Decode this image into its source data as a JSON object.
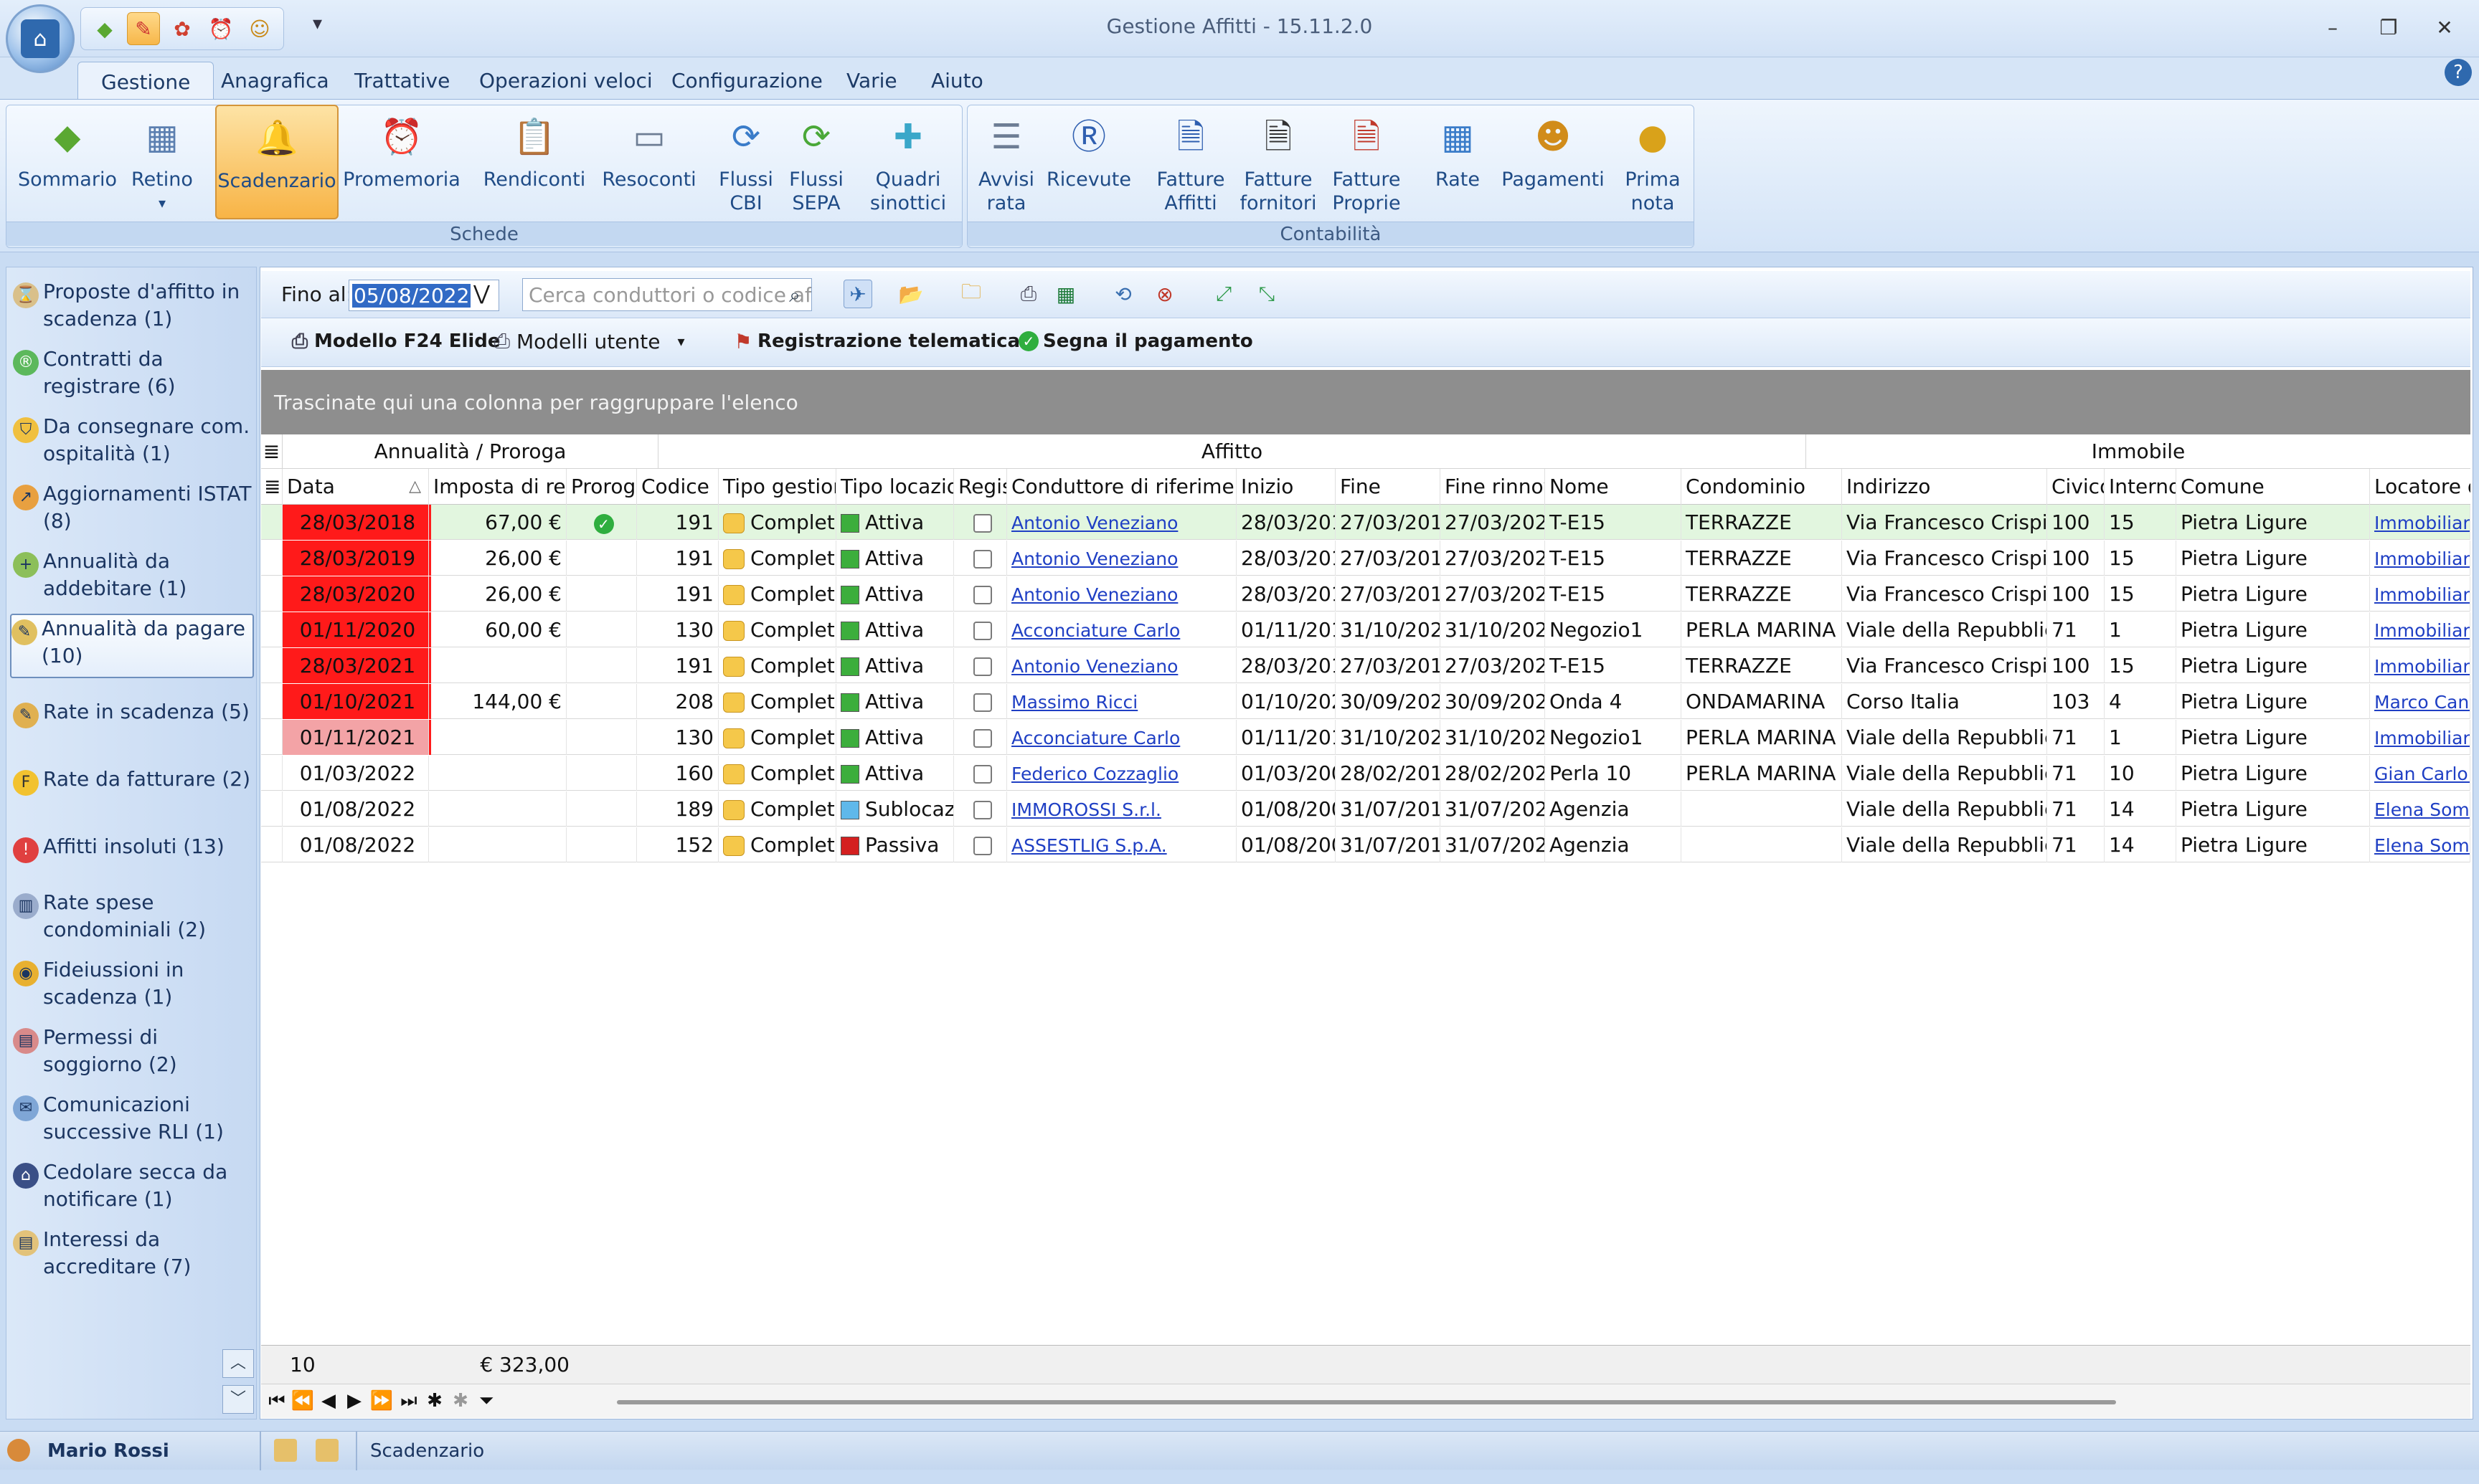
{
  "window": {
    "title": "Gestione Affitti - 15.11.2.0",
    "minimize": "–",
    "maximize": "❐",
    "close": "✕"
  },
  "qat": {
    "more": "▾"
  },
  "tabs": [
    "Gestione",
    "Anagrafica",
    "Trattative",
    "Operazioni veloci",
    "Configurazione",
    "Varie",
    "Aiuto"
  ],
  "ribbon": {
    "group_schede": "Schede",
    "group_contabilita": "Contabilità",
    "buttons": [
      "Sommario",
      "Retino",
      "Scadenzario",
      "Promemoria",
      "Rendiconti",
      "Resoconti",
      "Flussi CBI",
      "Flussi SEPA",
      "Quadri sinottici",
      "Avvisi rata",
      "Ricevute",
      "Fatture Affitti",
      "Fatture fornitori",
      "Fatture Proprie",
      "Rate",
      "Pagamenti",
      "Prima nota"
    ]
  },
  "left_panel": [
    "Proposte d'affitto in scadenza (1)",
    "Contratti da registrare (6)",
    "Da consegnare com. ospitalità (1)",
    "Aggiornamenti ISTAT (8)",
    "Annualità da addebitare (1)",
    "Annualità da pagare (10)",
    "Rate in scadenza (5)",
    "Rate da fatturare (2)",
    "Affitti insoluti (13)",
    "Rate spese condominiali (2)",
    "Fideiussioni in scadenza (1)",
    "Permessi di soggiorno (2)",
    "Comunicazioni successive RLI (1)",
    "Cedolare secca da notificare (1)",
    "Interessi da accreditare (7)"
  ],
  "toolbar": {
    "fino_al_label": "Fino al:",
    "fino_al_value": "05/08/2022",
    "search_placeholder": "Cerca conduttori o codice af",
    "modello_f24": "Modello F24 Elide",
    "modelli_utente": "Modelli utente",
    "registrazione": "Registrazione telematica",
    "segna_pagamento": "Segna il pagamento"
  },
  "groupbar": "Trascinate qui una colonna per raggruppare l'elenco",
  "bands": {
    "annualita": "Annualità / Proroga",
    "affitto": "Affitto",
    "immobile": "Immobile"
  },
  "columns": [
    "Data",
    "Imposta di reg",
    "Proroga",
    "Codice",
    "Tipo gestion",
    "Tipo locazior",
    "Regis",
    "Conduttore di riferimento",
    "Inizio",
    "Fine",
    "Fine rinnov",
    "Nome",
    "Condominio",
    "Indirizzo",
    "Civico",
    "Interno",
    "Comune",
    "Locatore d"
  ],
  "rows": [
    {
      "data": "28/03/2018",
      "imposta": "67,00 €",
      "proroga": "✓",
      "codice": "191",
      "gestione": "Complet",
      "locazione": "Attiva",
      "conduttore": "Antonio Veneziano",
      "inizio": "28/03/201",
      "fine": "27/03/201",
      "fine_rinnovo": "27/03/202",
      "nome": "T-E15",
      "condominio": "TERRAZZE",
      "indirizzo": "Via Francesco Crispi",
      "civico": "100",
      "interno": "15",
      "comune": "Pietra Ligure",
      "locatore": "Immobiliare"
    },
    {
      "data": "28/03/2019",
      "imposta": "26,00 €",
      "proroga": "",
      "codice": "191",
      "gestione": "Complet",
      "locazione": "Attiva",
      "conduttore": "Antonio Veneziano",
      "inizio": "28/03/201",
      "fine": "27/03/201",
      "fine_rinnovo": "27/03/202",
      "nome": "T-E15",
      "condominio": "TERRAZZE",
      "indirizzo": "Via Francesco Crispi",
      "civico": "100",
      "interno": "15",
      "comune": "Pietra Ligure",
      "locatore": "Immobiliare"
    },
    {
      "data": "28/03/2020",
      "imposta": "26,00 €",
      "proroga": "",
      "codice": "191",
      "gestione": "Complet",
      "locazione": "Attiva",
      "conduttore": "Antonio Veneziano",
      "inizio": "28/03/201",
      "fine": "27/03/201",
      "fine_rinnovo": "27/03/202",
      "nome": "T-E15",
      "condominio": "TERRAZZE",
      "indirizzo": "Via Francesco Crispi",
      "civico": "100",
      "interno": "15",
      "comune": "Pietra Ligure",
      "locatore": "Immobiliare"
    },
    {
      "data": "01/11/2020",
      "imposta": "60,00 €",
      "proroga": "",
      "codice": "130",
      "gestione": "Complet",
      "locazione": "Attiva",
      "conduttore": "Acconciature Carlo",
      "inizio": "01/11/201",
      "fine": "31/10/202",
      "fine_rinnovo": "31/10/202",
      "nome": "Negozio1",
      "condominio": "PERLA MARINA",
      "indirizzo": "Viale della Repubblica",
      "civico": "71",
      "interno": "1",
      "comune": "Pietra Ligure",
      "locatore": "Immobiliare"
    },
    {
      "data": "28/03/2021",
      "imposta": "",
      "proroga": "",
      "codice": "191",
      "gestione": "Complet",
      "locazione": "Attiva",
      "conduttore": "Antonio Veneziano",
      "inizio": "28/03/201",
      "fine": "27/03/201",
      "fine_rinnovo": "27/03/202",
      "nome": "T-E15",
      "condominio": "TERRAZZE",
      "indirizzo": "Via Francesco Crispi",
      "civico": "100",
      "interno": "15",
      "comune": "Pietra Ligure",
      "locatore": "Immobiliare"
    },
    {
      "data": "01/10/2021",
      "imposta": "144,00 €",
      "proroga": "",
      "codice": "208",
      "gestione": "Complet",
      "locazione": "Attiva",
      "conduttore": "Massimo Ricci",
      "inizio": "01/10/202",
      "fine": "30/09/202",
      "fine_rinnovo": "30/09/202",
      "nome": "Onda 4",
      "condominio": "ONDAMARINA",
      "indirizzo": "Corso Italia",
      "civico": "103",
      "interno": "4",
      "comune": "Pietra Ligure",
      "locatore": "Marco Cane"
    },
    {
      "data": "01/11/2021",
      "imposta": "",
      "proroga": "",
      "codice": "130",
      "gestione": "Complet",
      "locazione": "Attiva",
      "conduttore": "Acconciature Carlo",
      "inizio": "01/11/201",
      "fine": "31/10/202",
      "fine_rinnovo": "31/10/202",
      "nome": "Negozio1",
      "condominio": "PERLA MARINA",
      "indirizzo": "Viale della Repubblica",
      "civico": "71",
      "interno": "1",
      "comune": "Pietra Ligure",
      "locatore": "Immobiliare"
    },
    {
      "data": "01/03/2022",
      "imposta": "",
      "proroga": "",
      "codice": "160",
      "gestione": "Complet",
      "locazione": "Attiva",
      "conduttore": "Federico Cozzaglio",
      "inizio": "01/03/200",
      "fine": "28/02/201",
      "fine_rinnovo": "28/02/202",
      "nome": "Perla 10",
      "condominio": "PERLA MARINA",
      "indirizzo": "Viale della Repubblica",
      "civico": "71",
      "interno": "10",
      "comune": "Pietra Ligure",
      "locatore": "Gian Carlo F"
    },
    {
      "data": "01/08/2022",
      "imposta": "",
      "proroga": "",
      "codice": "189",
      "gestione": "Complet",
      "locazione": "Sublocaz",
      "conduttore": "IMMOROSSI S.r.l.",
      "inizio": "01/08/200",
      "fine": "31/07/201",
      "fine_rinnovo": "31/07/202",
      "nome": "Agenzia",
      "condominio": "",
      "indirizzo": "Viale della Repubblica",
      "civico": "71",
      "interno": "14",
      "comune": "Pietra Ligure",
      "locatore": "Elena Somm"
    },
    {
      "data": "01/08/2022",
      "imposta": "",
      "proroga": "",
      "codice": "152",
      "gestione": "Complet",
      "locazione": "Passiva",
      "conduttore": "ASSESTLIG S.p.A.",
      "inizio": "01/08/200",
      "fine": "31/07/201",
      "fine_rinnovo": "31/07/202",
      "nome": "Agenzia",
      "condominio": "",
      "indirizzo": "Viale della Repubblica",
      "civico": "71",
      "interno": "14",
      "comune": "Pietra Ligure",
      "locatore": "Elena Somm"
    }
  ],
  "footer": {
    "count": "10",
    "total": "€ 323,00"
  },
  "statusbar": {
    "user": "Mario Rossi",
    "section": "Scadenzario"
  },
  "colors": {
    "overdue": "#ff1a1a",
    "soon": "#f3a3a6",
    "selected_row": "#e2f6df",
    "attiva": "#3cae3c",
    "sublocazione": "#5fb8ea",
    "passiva": "#d42020"
  }
}
